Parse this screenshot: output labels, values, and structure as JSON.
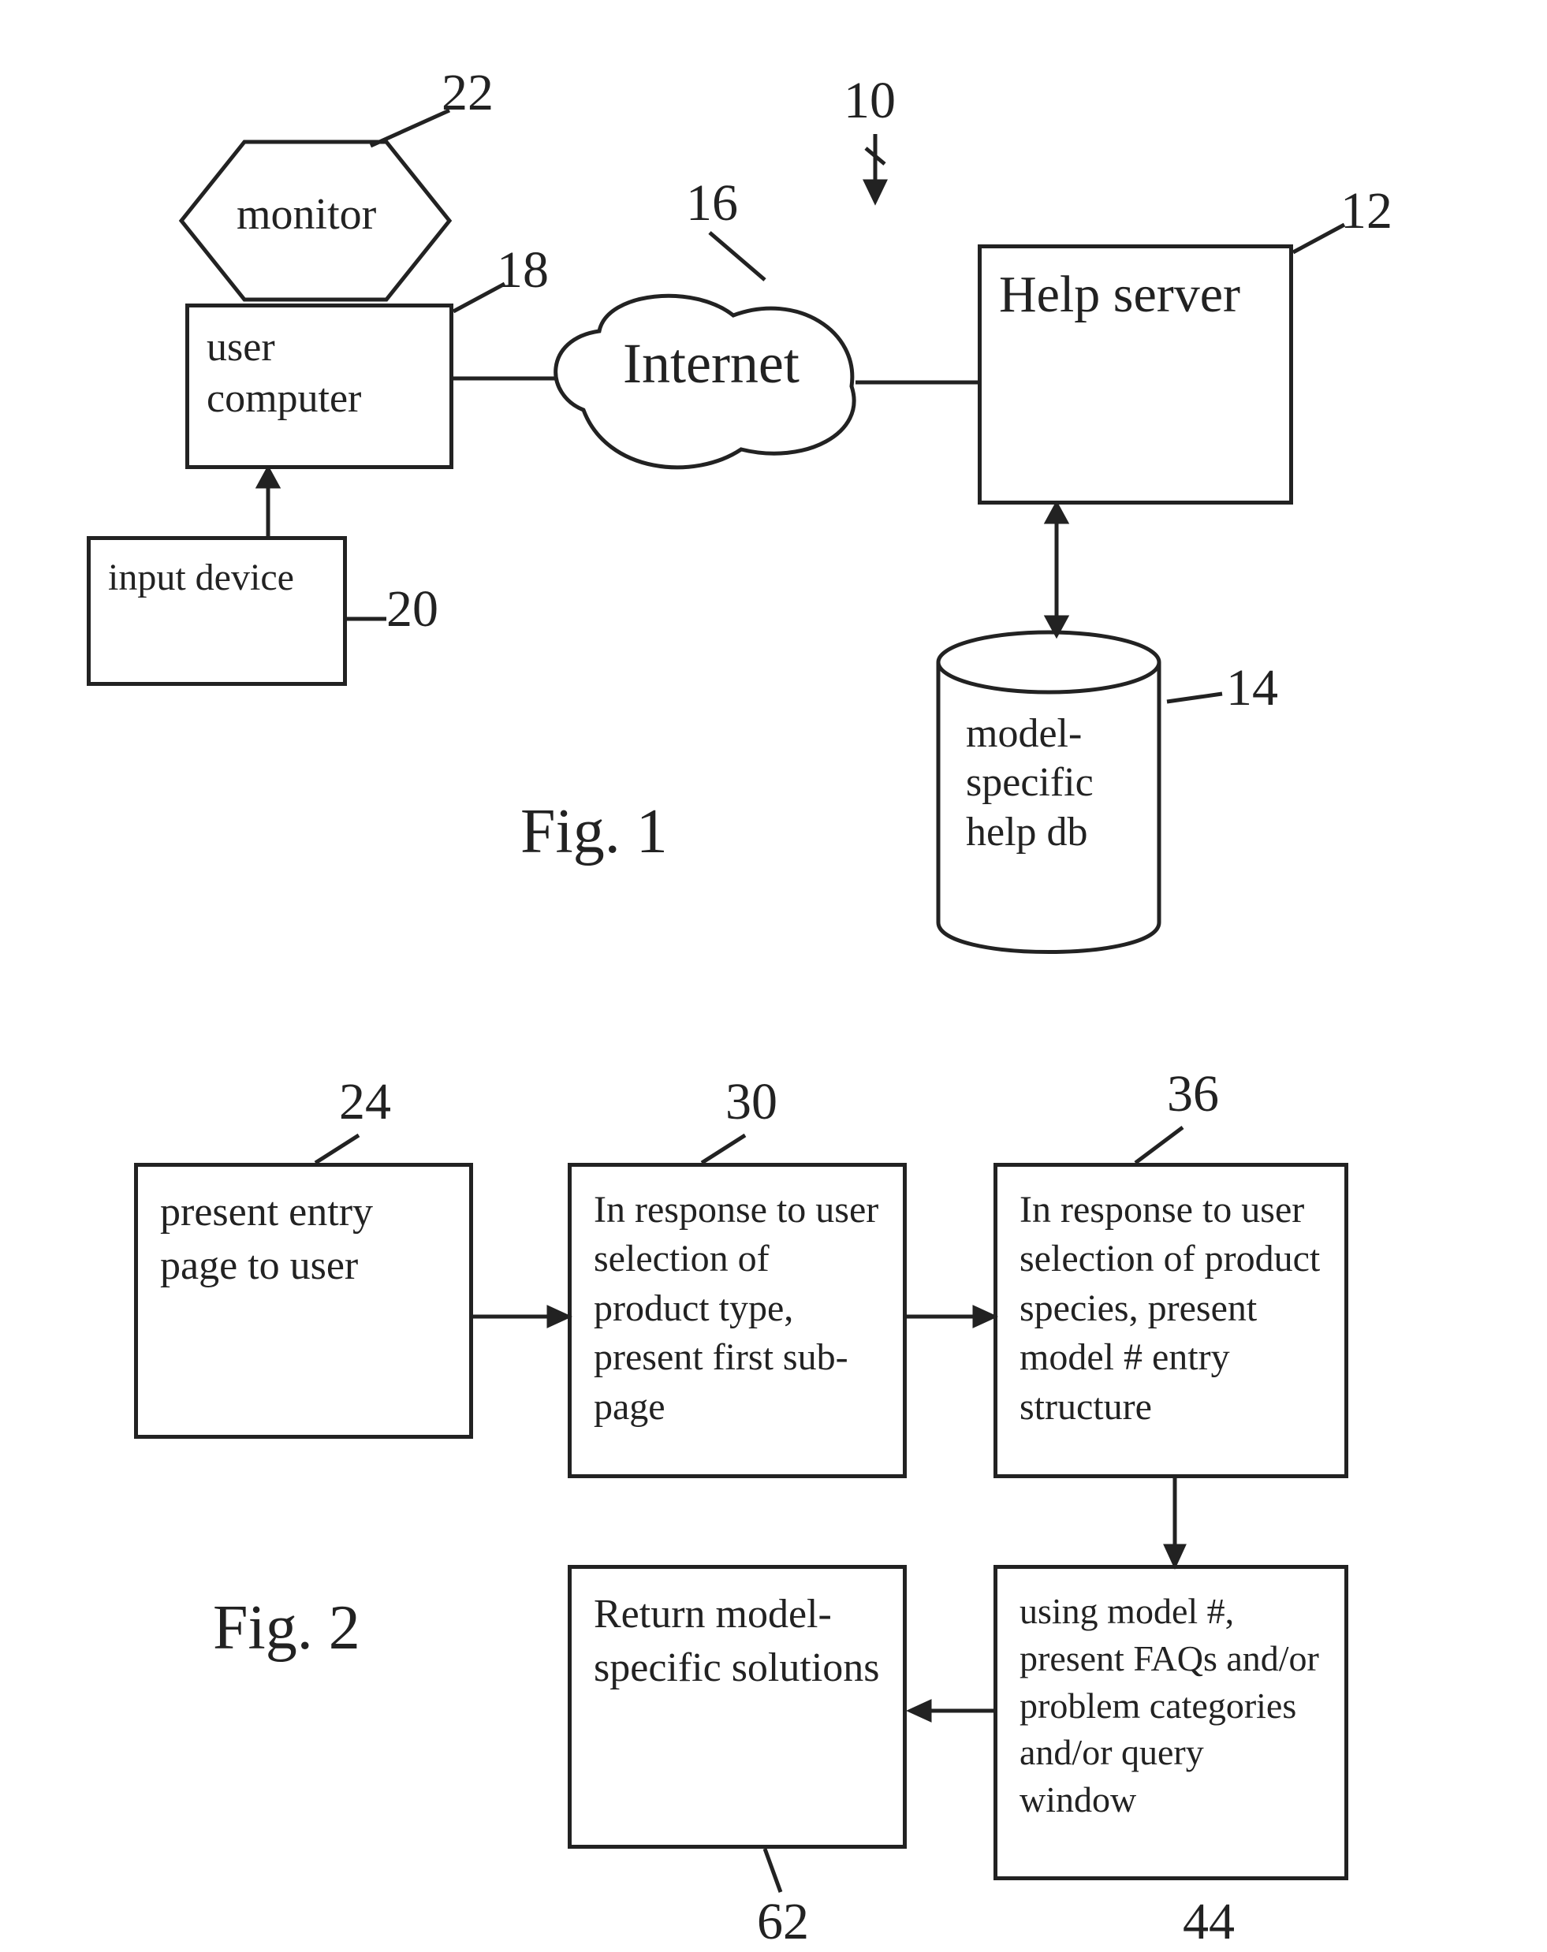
{
  "figure1": {
    "caption": "Fig. 1",
    "system_ref": "10",
    "nodes": {
      "monitor": {
        "label": "monitor",
        "ref": "22"
      },
      "user_computer": {
        "label": "user computer",
        "ref": "18"
      },
      "input_device": {
        "label": "input device",
        "ref": "20"
      },
      "internet": {
        "label": "Internet",
        "ref": "16"
      },
      "help_server": {
        "label": "Help server",
        "ref": "12"
      },
      "db": {
        "label": "model-specific help db",
        "ref": "14"
      }
    }
  },
  "figure2": {
    "caption": "Fig. 2",
    "steps": {
      "s24": {
        "ref": "24",
        "label": "present entry page to user"
      },
      "s30": {
        "ref": "30",
        "label": "In response to user selection of product type, present first sub-page"
      },
      "s36": {
        "ref": "36",
        "label": "In response to user selection of product species, present model # entry structure"
      },
      "s44": {
        "ref": "44",
        "label": "using model #, present FAQs and/or problem categories and/or query window"
      },
      "s62": {
        "ref": "62",
        "label": "Return model-specific solutions"
      }
    }
  }
}
